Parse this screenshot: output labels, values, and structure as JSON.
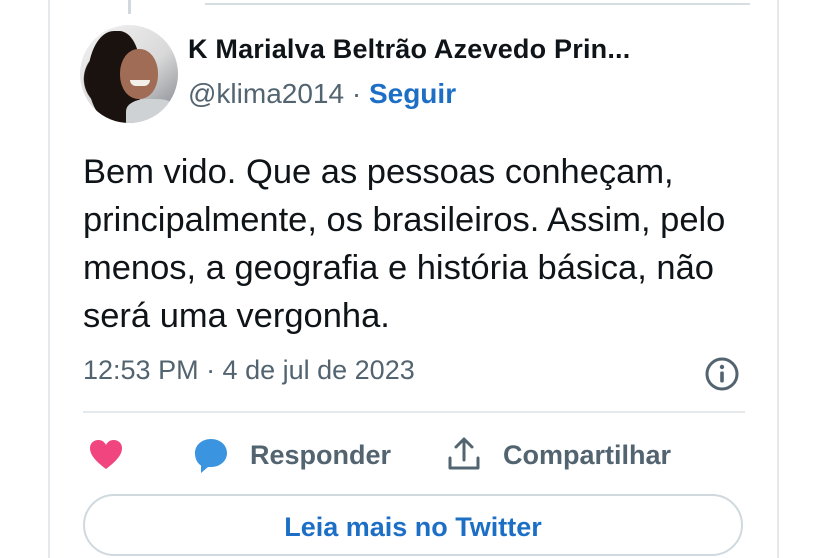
{
  "tweet": {
    "author": {
      "name": "K Marialva Beltrão Azevedo Prin...",
      "handle": "@klima2014",
      "separator": "·",
      "follow_label": "Seguir"
    },
    "text": "Bem vido. Que as pessoas conheçam, principalmente, os brasileiros. Assim, pelo menos, a geografia e história básica, não será uma vergonha.",
    "timestamp": "12:53 PM · 4 de jul de 2023",
    "actions": {
      "reply_label": "Responder",
      "share_label": "Compartilhar"
    },
    "read_more_label": "Leia mais no Twitter"
  },
  "colors": {
    "accent": "#1d6fc6",
    "heart": "#f0457e",
    "reply_icon": "#3b94e0",
    "muted": "#536471"
  },
  "icons": [
    "info-icon",
    "heart-icon",
    "reply-icon",
    "share-icon"
  ]
}
